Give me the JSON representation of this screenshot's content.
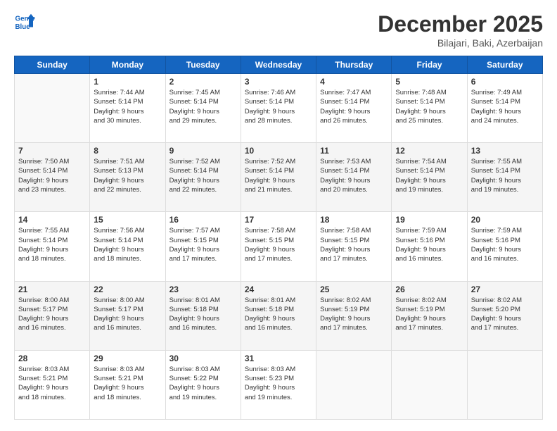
{
  "logo": {
    "line1": "General",
    "line2": "Blue"
  },
  "title": "December 2025",
  "location": "Bilajari, Baki, Azerbaijan",
  "days_of_week": [
    "Sunday",
    "Monday",
    "Tuesday",
    "Wednesday",
    "Thursday",
    "Friday",
    "Saturday"
  ],
  "weeks": [
    [
      {
        "day": "",
        "info": ""
      },
      {
        "day": "1",
        "info": "Sunrise: 7:44 AM\nSunset: 5:14 PM\nDaylight: 9 hours\nand 30 minutes."
      },
      {
        "day": "2",
        "info": "Sunrise: 7:45 AM\nSunset: 5:14 PM\nDaylight: 9 hours\nand 29 minutes."
      },
      {
        "day": "3",
        "info": "Sunrise: 7:46 AM\nSunset: 5:14 PM\nDaylight: 9 hours\nand 28 minutes."
      },
      {
        "day": "4",
        "info": "Sunrise: 7:47 AM\nSunset: 5:14 PM\nDaylight: 9 hours\nand 26 minutes."
      },
      {
        "day": "5",
        "info": "Sunrise: 7:48 AM\nSunset: 5:14 PM\nDaylight: 9 hours\nand 25 minutes."
      },
      {
        "day": "6",
        "info": "Sunrise: 7:49 AM\nSunset: 5:14 PM\nDaylight: 9 hours\nand 24 minutes."
      }
    ],
    [
      {
        "day": "7",
        "info": "Sunrise: 7:50 AM\nSunset: 5:14 PM\nDaylight: 9 hours\nand 23 minutes."
      },
      {
        "day": "8",
        "info": "Sunrise: 7:51 AM\nSunset: 5:13 PM\nDaylight: 9 hours\nand 22 minutes."
      },
      {
        "day": "9",
        "info": "Sunrise: 7:52 AM\nSunset: 5:14 PM\nDaylight: 9 hours\nand 22 minutes."
      },
      {
        "day": "10",
        "info": "Sunrise: 7:52 AM\nSunset: 5:14 PM\nDaylight: 9 hours\nand 21 minutes."
      },
      {
        "day": "11",
        "info": "Sunrise: 7:53 AM\nSunset: 5:14 PM\nDaylight: 9 hours\nand 20 minutes."
      },
      {
        "day": "12",
        "info": "Sunrise: 7:54 AM\nSunset: 5:14 PM\nDaylight: 9 hours\nand 19 minutes."
      },
      {
        "day": "13",
        "info": "Sunrise: 7:55 AM\nSunset: 5:14 PM\nDaylight: 9 hours\nand 19 minutes."
      }
    ],
    [
      {
        "day": "14",
        "info": "Sunrise: 7:55 AM\nSunset: 5:14 PM\nDaylight: 9 hours\nand 18 minutes."
      },
      {
        "day": "15",
        "info": "Sunrise: 7:56 AM\nSunset: 5:14 PM\nDaylight: 9 hours\nand 18 minutes."
      },
      {
        "day": "16",
        "info": "Sunrise: 7:57 AM\nSunset: 5:15 PM\nDaylight: 9 hours\nand 17 minutes."
      },
      {
        "day": "17",
        "info": "Sunrise: 7:58 AM\nSunset: 5:15 PM\nDaylight: 9 hours\nand 17 minutes."
      },
      {
        "day": "18",
        "info": "Sunrise: 7:58 AM\nSunset: 5:15 PM\nDaylight: 9 hours\nand 17 minutes."
      },
      {
        "day": "19",
        "info": "Sunrise: 7:59 AM\nSunset: 5:16 PM\nDaylight: 9 hours\nand 16 minutes."
      },
      {
        "day": "20",
        "info": "Sunrise: 7:59 AM\nSunset: 5:16 PM\nDaylight: 9 hours\nand 16 minutes."
      }
    ],
    [
      {
        "day": "21",
        "info": "Sunrise: 8:00 AM\nSunset: 5:17 PM\nDaylight: 9 hours\nand 16 minutes."
      },
      {
        "day": "22",
        "info": "Sunrise: 8:00 AM\nSunset: 5:17 PM\nDaylight: 9 hours\nand 16 minutes."
      },
      {
        "day": "23",
        "info": "Sunrise: 8:01 AM\nSunset: 5:18 PM\nDaylight: 9 hours\nand 16 minutes."
      },
      {
        "day": "24",
        "info": "Sunrise: 8:01 AM\nSunset: 5:18 PM\nDaylight: 9 hours\nand 16 minutes."
      },
      {
        "day": "25",
        "info": "Sunrise: 8:02 AM\nSunset: 5:19 PM\nDaylight: 9 hours\nand 17 minutes."
      },
      {
        "day": "26",
        "info": "Sunrise: 8:02 AM\nSunset: 5:19 PM\nDaylight: 9 hours\nand 17 minutes."
      },
      {
        "day": "27",
        "info": "Sunrise: 8:02 AM\nSunset: 5:20 PM\nDaylight: 9 hours\nand 17 minutes."
      }
    ],
    [
      {
        "day": "28",
        "info": "Sunrise: 8:03 AM\nSunset: 5:21 PM\nDaylight: 9 hours\nand 18 minutes."
      },
      {
        "day": "29",
        "info": "Sunrise: 8:03 AM\nSunset: 5:21 PM\nDaylight: 9 hours\nand 18 minutes."
      },
      {
        "day": "30",
        "info": "Sunrise: 8:03 AM\nSunset: 5:22 PM\nDaylight: 9 hours\nand 19 minutes."
      },
      {
        "day": "31",
        "info": "Sunrise: 8:03 AM\nSunset: 5:23 PM\nDaylight: 9 hours\nand 19 minutes."
      },
      {
        "day": "",
        "info": ""
      },
      {
        "day": "",
        "info": ""
      },
      {
        "day": "",
        "info": ""
      }
    ]
  ]
}
